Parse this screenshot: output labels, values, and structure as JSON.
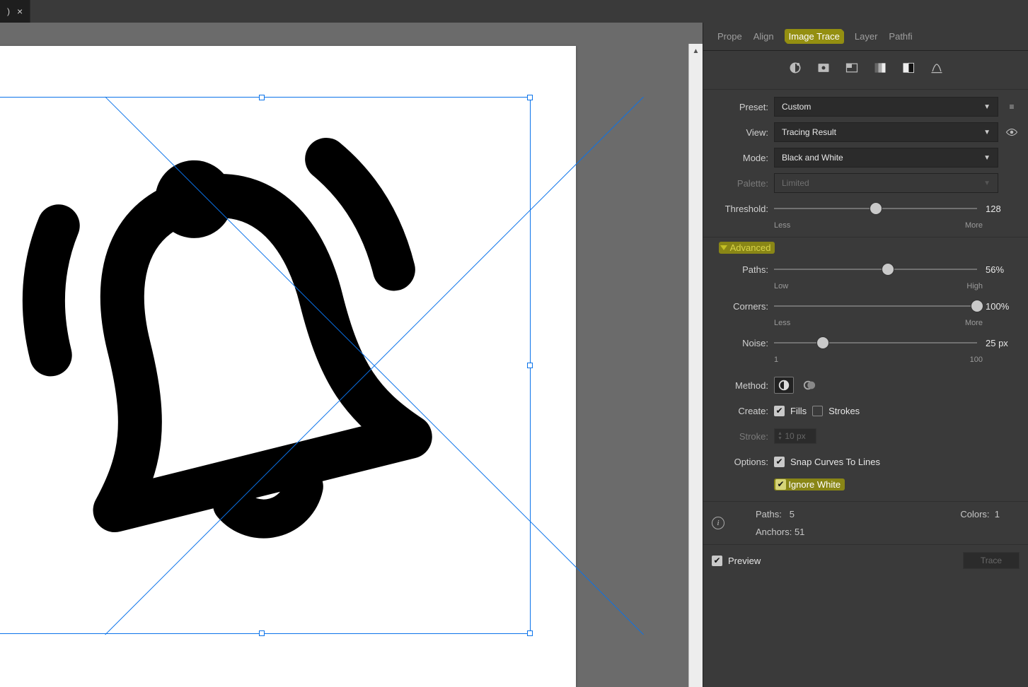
{
  "docTab": {
    "name": ")",
    "close": "×"
  },
  "tabs": [
    "Prope",
    "Align",
    "Image Trace",
    "Layer",
    "Pathfi"
  ],
  "activeTab": "Image Trace",
  "preset": {
    "label": "Preset:",
    "value": "Custom"
  },
  "view": {
    "label": "View:",
    "value": "Tracing Result"
  },
  "mode": {
    "label": "Mode:",
    "value": "Black and White"
  },
  "palette": {
    "label": "Palette:",
    "value": "Limited"
  },
  "threshold": {
    "label": "Threshold:",
    "value": "128",
    "low": "Less",
    "high": "More",
    "pos": 50
  },
  "advanced": "Advanced",
  "paths": {
    "label": "Paths:",
    "value": "56%",
    "low": "Low",
    "high": "High",
    "pos": 56
  },
  "corners": {
    "label": "Corners:",
    "value": "100%",
    "low": "Less",
    "high": "More",
    "pos": 100
  },
  "noise": {
    "label": "Noise:",
    "value": "25 px",
    "low": "1",
    "high": "100",
    "pos": 24
  },
  "method": {
    "label": "Method:"
  },
  "create": {
    "label": "Create:",
    "fills": "Fills",
    "strokes": "Strokes"
  },
  "stroke": {
    "label": "Stroke:",
    "value": "10 px"
  },
  "options": {
    "label": "Options:",
    "snap": "Snap Curves To Lines",
    "ignore": "Ignore White"
  },
  "stats": {
    "paths": "Paths:",
    "pathsVal": "5",
    "colors": "Colors:",
    "colorsVal": "1",
    "anchors": "Anchors:",
    "anchorsVal": "51"
  },
  "preview": "Preview",
  "traceBtn": "Trace"
}
